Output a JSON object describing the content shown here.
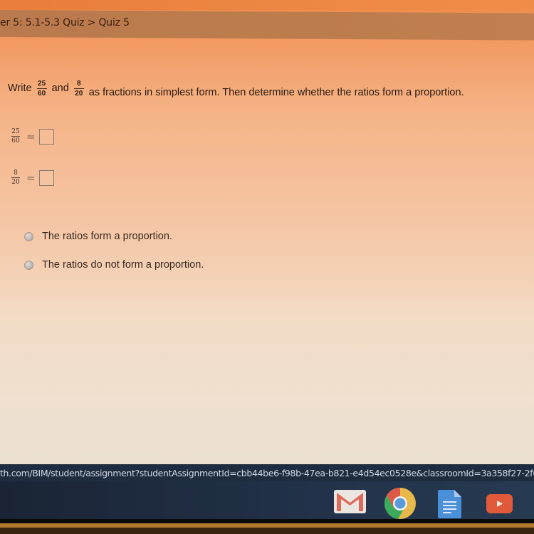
{
  "breadcrumb": "er 5: 5.1-5.3 Quiz > Quiz 5",
  "question": {
    "prefix": "Write",
    "frac1": {
      "num": "25",
      "den": "60"
    },
    "middle": "and",
    "frac2": {
      "num": "8",
      "den": "20"
    },
    "suffix": "as fractions in simplest form. Then determine whether the ratios form a proportion."
  },
  "equations": [
    {
      "num": "25",
      "den": "60",
      "sign": "=",
      "answer": ""
    },
    {
      "num": "8",
      "den": "20",
      "sign": "=",
      "answer": ""
    }
  ],
  "options": [
    {
      "label": "The ratios form a proportion.",
      "selected": false
    },
    {
      "label": "The ratios do not form a proportion.",
      "selected": false
    }
  ],
  "status_url": "th.com/BIM/student/assignment?studentAssignmentId=cbb44be6-f98b-47ea-b821-e4d54ec0528e&classroomId=3a358f27-2f6",
  "shelf": {
    "apps": [
      {
        "name": "Gmail",
        "icon": "gmail-icon"
      },
      {
        "name": "Chrome",
        "icon": "chrome-icon",
        "active": true
      },
      {
        "name": "Docs",
        "icon": "docs-icon"
      },
      {
        "name": "YouTube",
        "icon": "youtube-icon"
      }
    ]
  },
  "colors": {
    "breadcrumb_bar": "#bd7c4c",
    "shelf": "#1e2c40",
    "gmail_red": "#e06a5a",
    "docs_blue": "#4a90d8",
    "youtube_red": "#e05a3a"
  }
}
